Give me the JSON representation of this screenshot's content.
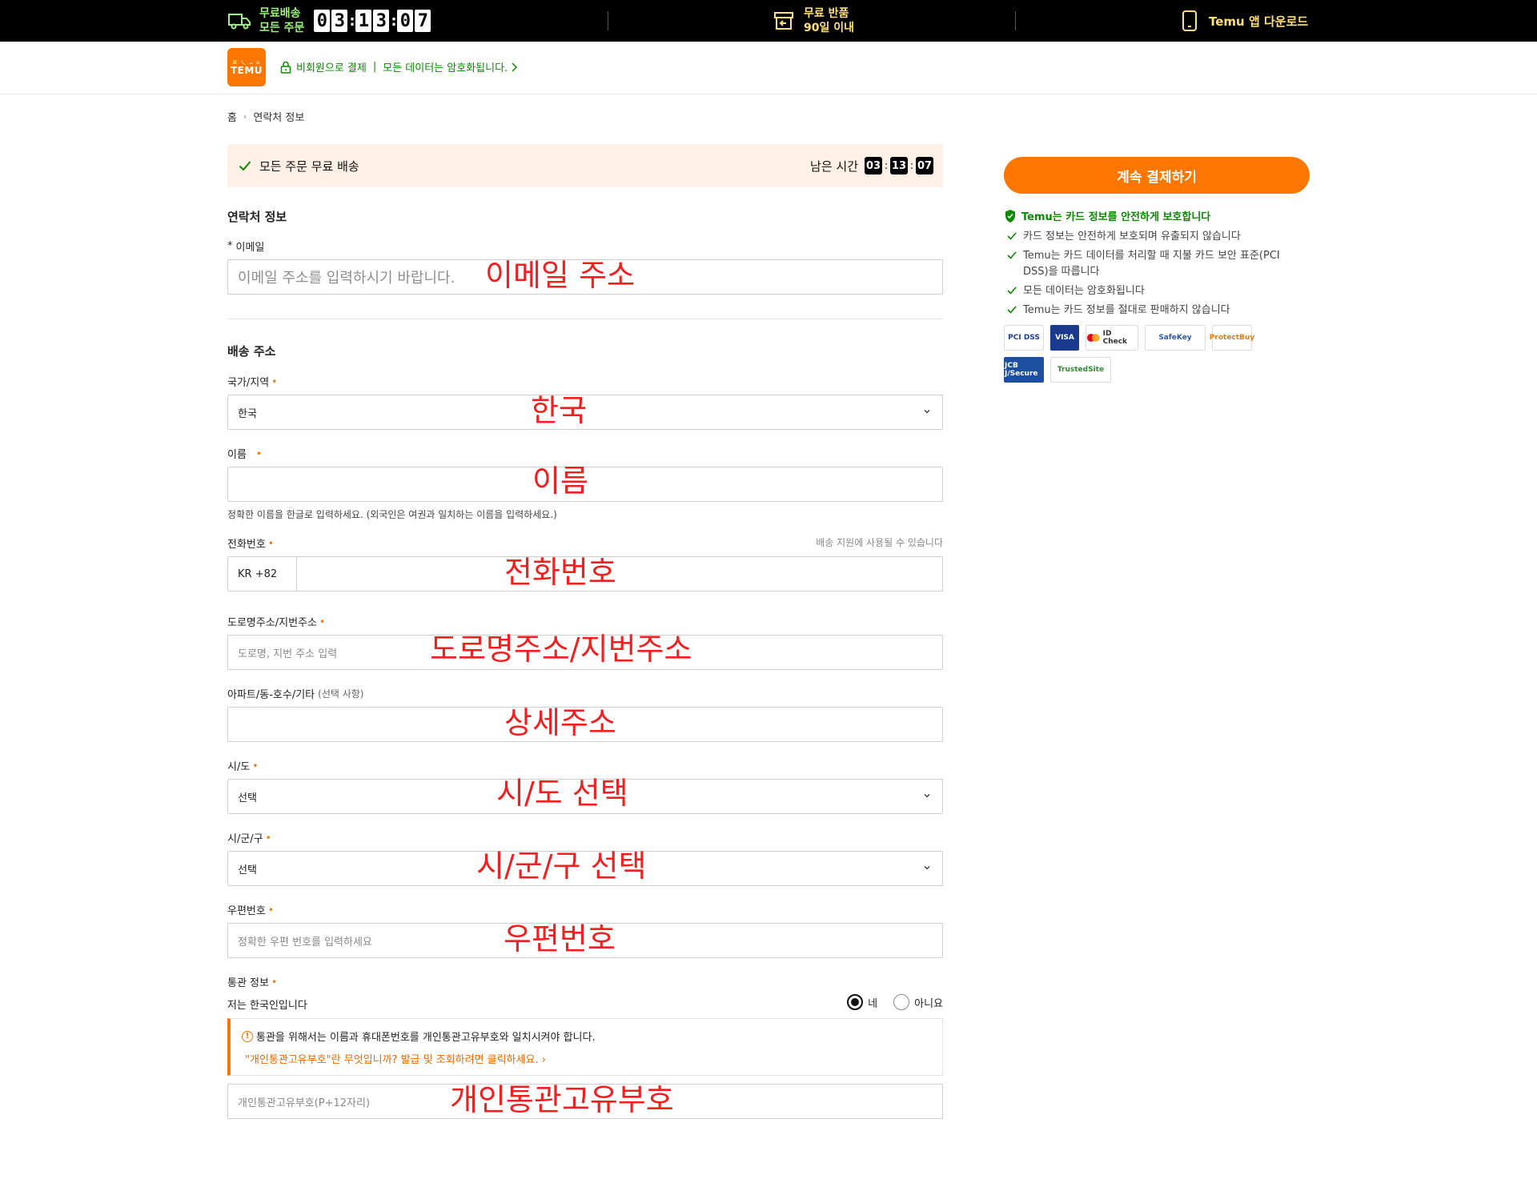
{
  "topbar": {
    "shipping_line1": "무료배송",
    "shipping_line2": "모든 주문",
    "countdown": [
      "0",
      "3",
      ":",
      "1",
      "3",
      ":",
      "0",
      "7"
    ],
    "returns_line1": "무료 반품",
    "returns_line2": "90일 이내",
    "app_download": "Temu 앱 다운로드"
  },
  "header": {
    "logo_glyphs": "ꕤ 乀 ᴗ ⌂",
    "logo_text": "TEMU",
    "guest_checkout": "비회원으로 결제",
    "separator": "|",
    "encrypted": "모든 데이터는 암호화됩니다."
  },
  "breadcrumb": {
    "home": "홈",
    "current": "연락처 정보"
  },
  "banner": {
    "text": "모든 주문 무료 배송",
    "remaining_label": "남은 시간",
    "hh": "03",
    "mm": "13",
    "ss": "07"
  },
  "contact": {
    "section_title": "연락처 정보",
    "email_star": "*",
    "email_label": "이메일",
    "email_placeholder": "이메일 주소를 입력하시기 바랍니다.",
    "email_overlay": "이메일 주소"
  },
  "shipping": {
    "section_title": "배송 주소",
    "country_label": "국가/지역",
    "country_value": "한국",
    "country_overlay": "한국",
    "name_label": "이름",
    "name_overlay": "이름",
    "name_hint": "정확한 이름을 한글로 입력하세요. (외국인은 여권과 일치하는 이름을 입력하세요.)",
    "phone_label": "전화번호",
    "phone_hint": "배송 지원에 사용될 수 있습니다",
    "phone_prefix": "KR +82",
    "phone_overlay": "전화번호",
    "road_label": "도로명주소/지번주소",
    "road_placeholder": "도로명, 지번 주소 입력",
    "road_overlay": "도로명주소/지번주소",
    "apt_label": "아파트/동-호수/기타",
    "apt_optional": "(선택 사항)",
    "apt_overlay": "상세주소",
    "province_label": "시/도",
    "province_value": "선택",
    "province_overlay": "시/도 선택",
    "city_label": "시/군/구",
    "city_value": "선택",
    "city_overlay": "시/군/구 선택",
    "zip_label": "우편번호",
    "zip_placeholder": "정확한 우편 번호를 입력하세요",
    "zip_overlay": "우편번호",
    "req_mark": "•"
  },
  "customs": {
    "label": "통관 정보",
    "korean_question": "저는 한국인입니다",
    "yes": "네",
    "no": "아니요",
    "notice_icon": "!",
    "notice_line1": "통관을 위해서는 이름과 휴대폰번호를 개인통관고유부호와 일치시켜야 합니다.",
    "notice_line2": "\"개인통관고유부호\"란 무엇입니까? 발급 및 조회하려면 클릭하세요.",
    "notice_chev": "›",
    "code_placeholder": "개인통관고유부호(P+12자리)",
    "code_overlay": "개인통관고유부호"
  },
  "sidebar": {
    "checkout_button": "계속 결제하기",
    "protect_title": "Temu는 카드 정보를 안전하게 보호합니다",
    "protect_items": [
      "카드 정보는 안전하게 보호되며 유출되지 않습니다",
      "Temu는 카드 데이터를 처리할 때 지불 카드 보안 표준(PCI DSS)을 따릅니다",
      "모든 데이터는 암호화됩니다",
      "Temu는 카드 정보를 절대로 판매하지 않습니다"
    ],
    "badges": [
      "PCI DSS",
      "VISA",
      "ID Check",
      "SafeKey",
      "ProtectBuy",
      "JCB J/Secure",
      "TrustedSite"
    ]
  },
  "colors": {
    "accent": "#fb7701",
    "secure_green": "#0a8800",
    "overlay_red": "#f02020"
  }
}
